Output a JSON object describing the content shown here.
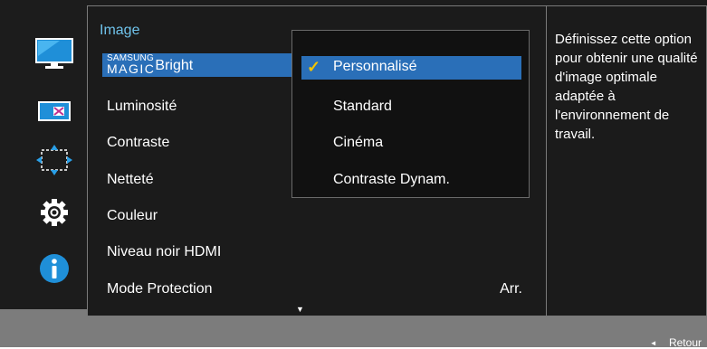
{
  "menu": {
    "title": "Image",
    "items": [
      {
        "label_top": "SAMSUNG",
        "label_bottom": "MAGIC",
        "label_suffix": "Bright"
      },
      {
        "label": "Luminosité"
      },
      {
        "label": "Contraste"
      },
      {
        "label": "Netteté"
      },
      {
        "label": "Couleur"
      },
      {
        "label": "Niveau noir HDMI"
      },
      {
        "label": "Mode Protection",
        "value": "Arr."
      }
    ]
  },
  "dropdown": {
    "options": [
      "Personnalisé",
      "Standard",
      "Cinéma",
      "Contraste Dynam."
    ],
    "selected_index": 0,
    "check": "✓"
  },
  "help": {
    "text": "Définissez cette option pour obtenir une qualité d'image optimale adaptée à l'environnement de travail."
  },
  "footer": {
    "back_label": "Retour",
    "back_arrow": "◄"
  },
  "sidebar_icons": [
    "monitor-icon",
    "picture-size-icon",
    "position-icon",
    "gear-icon",
    "info-icon"
  ],
  "scroll_indicator": "▼",
  "colors": {
    "selection": "#2a6fb8",
    "title": "#6fc2ea",
    "check": "#f2c400"
  }
}
